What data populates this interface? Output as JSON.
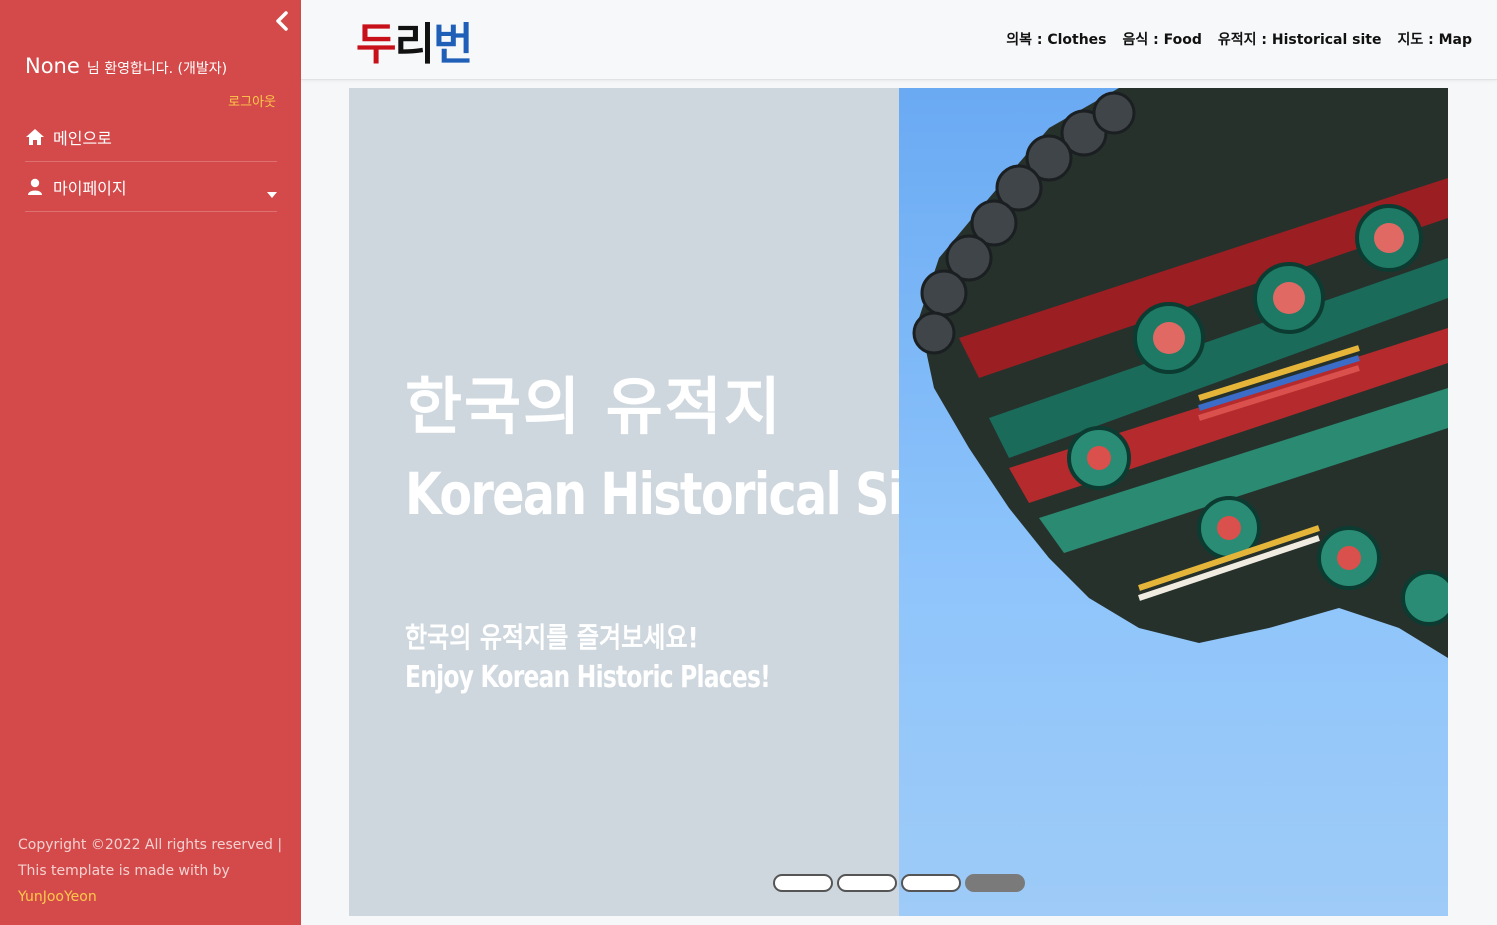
{
  "sidebar": {
    "user_name": "None",
    "greeting": "님 환영합니다. (개발자)",
    "logout": "로그아웃",
    "menu": [
      {
        "label": "메인으로",
        "icon": "home-icon"
      },
      {
        "label": "마이페이지",
        "icon": "user-icon"
      }
    ],
    "footer": {
      "text": "Copyright ©2022 All rights reserved | This template is made with by ",
      "author": "YunJooYeon"
    }
  },
  "navbar": {
    "logo": [
      "두",
      "리",
      "번"
    ],
    "links": [
      "의복 : Clothes",
      "음식 : Food",
      "유적지 : Historical site",
      "지도 : Map"
    ]
  },
  "carousel": {
    "title_kr": "한국의 유적지",
    "title_en": "Korean Historical Site",
    "subtitle_kr": "한국의 유적지를  즐겨보세요!",
    "subtitle_en": "Enjoy Korean Historic Places!",
    "slide_count": 4,
    "active_index": 3
  },
  "colors": {
    "sidebar_bg": "#d44a4a",
    "accent": "#ffc94a",
    "logo_red": "#c8101a",
    "logo_blue": "#1f5fb8"
  }
}
